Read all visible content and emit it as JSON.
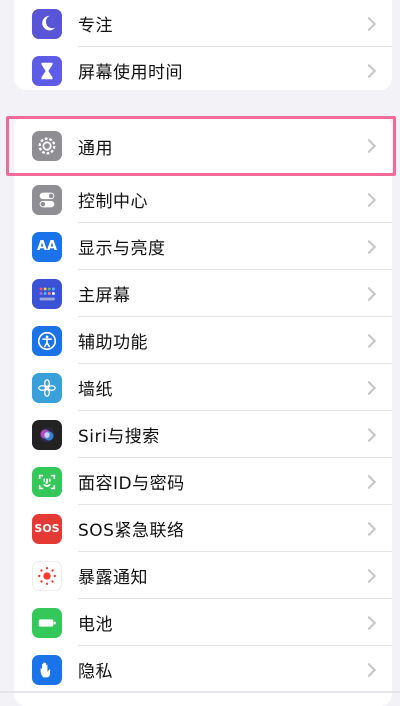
{
  "top_group": [
    {
      "name": "focus",
      "label": "专注",
      "icon": "moon-icon",
      "color": "#5856d6"
    },
    {
      "name": "screen-time",
      "label": "屏幕使用时间",
      "icon": "hourglass-icon",
      "color": "#5e5ce6"
    }
  ],
  "main_group": [
    {
      "name": "general",
      "label": "通用",
      "icon": "gear-icon",
      "color": "#8e8e93"
    },
    {
      "name": "control-center",
      "label": "控制中心",
      "icon": "toggle-icon",
      "color": "#8e8e93"
    },
    {
      "name": "display-brightness",
      "label": "显示与亮度",
      "icon": "aa-icon",
      "icon_text": "AA",
      "color": "#1a73e8"
    },
    {
      "name": "home-screen",
      "label": "主屏幕",
      "icon": "home-grid-icon",
      "color": "#3a52d6"
    },
    {
      "name": "accessibility",
      "label": "辅助功能",
      "icon": "accessibility-icon",
      "color": "#1a73e8"
    },
    {
      "name": "wallpaper",
      "label": "墙纸",
      "icon": "flower-icon",
      "color": "#3aa0d9"
    },
    {
      "name": "siri-search",
      "label": "Siri与搜索",
      "icon": "siri-icon",
      "color": "#222"
    },
    {
      "name": "face-id-passcode",
      "label": "面容ID与密码",
      "icon": "face-id-icon",
      "color": "#34c759"
    },
    {
      "name": "emergency-sos",
      "label": "SOS紧急联络",
      "icon": "sos-icon",
      "icon_text": "SOS",
      "color": "#e53935"
    },
    {
      "name": "exposure-notifications",
      "label": "暴露通知",
      "icon": "exposure-icon",
      "color": "#ffffff"
    },
    {
      "name": "battery",
      "label": "电池",
      "icon": "battery-icon",
      "color": "#34c759"
    },
    {
      "name": "privacy",
      "label": "隐私",
      "icon": "hand-icon",
      "color": "#1a73e8"
    }
  ],
  "highlighted_item": "general",
  "highlight_color": "#f06b97"
}
